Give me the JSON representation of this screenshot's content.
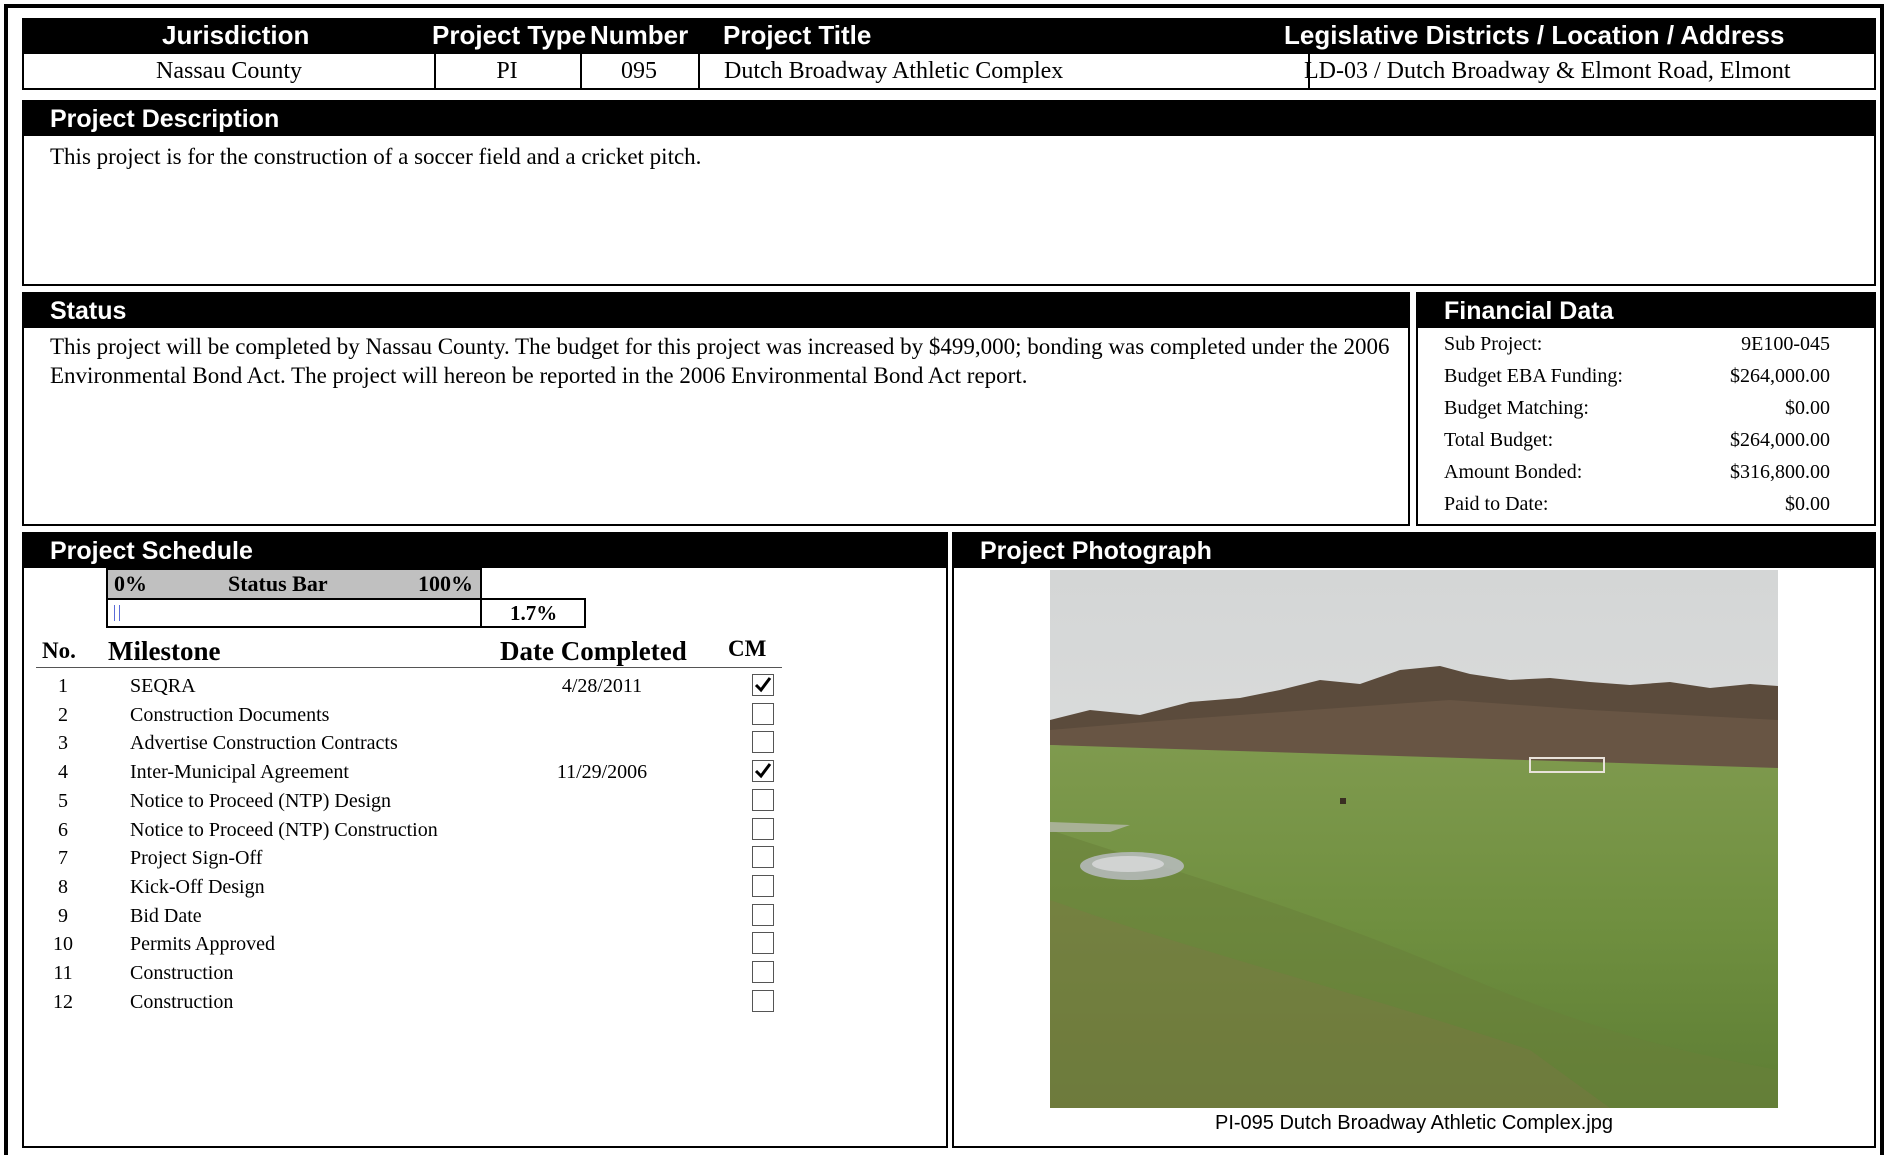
{
  "header": {
    "columns": [
      "Jurisdiction",
      "Project Type",
      "Number",
      "Project Title",
      "Legislative Districts / Location / Address"
    ],
    "values": {
      "jurisdiction": "Nassau County",
      "project_type": "PI",
      "number": "095",
      "project_title": "Dutch Broadway Athletic Complex",
      "location": "LD-03 / Dutch Broadway & Elmont Road, Elmont"
    }
  },
  "description": {
    "title": "Project Description",
    "text": "This project is for the construction of a soccer field and a cricket pitch."
  },
  "status": {
    "title": "Status",
    "text": "This project will be completed by Nassau County. The budget for this project was increased by $499,000; bonding was completed under the 2006 Environmental Bond Act. The project will hereon be reported in the 2006 Environmental Bond Act report."
  },
  "financial": {
    "title": "Financial Data",
    "rows": [
      {
        "label": "Sub Project:",
        "value": "9E100-045"
      },
      {
        "label": "Budget EBA Funding:",
        "value": "$264,000.00"
      },
      {
        "label": "Budget Matching:",
        "value": "$0.00"
      },
      {
        "label": "Total Budget:",
        "value": "$264,000.00"
      },
      {
        "label": "Amount Bonded:",
        "value": "$316,800.00"
      },
      {
        "label": "Paid to Date:",
        "value": "$0.00"
      }
    ]
  },
  "schedule": {
    "title": "Project Schedule",
    "status_bar": {
      "min_label": "0%",
      "label": "Status Bar",
      "max_label": "100%",
      "percent_text": "1.7%",
      "fraction": 0.017
    },
    "columns": {
      "no": "No.",
      "milestone": "Milestone",
      "date": "Date Completed",
      "cm": "CM"
    },
    "milestones": [
      {
        "no": "1",
        "name": "SEQRA",
        "date": "4/28/2011",
        "cm": true
      },
      {
        "no": "2",
        "name": "Construction Documents",
        "date": "",
        "cm": false
      },
      {
        "no": "3",
        "name": "Advertise Construction Contracts",
        "date": "",
        "cm": false
      },
      {
        "no": "4",
        "name": "Inter-Municipal Agreement",
        "date": "11/29/2006",
        "cm": true
      },
      {
        "no": "5",
        "name": "Notice to Proceed (NTP) Design",
        "date": "",
        "cm": false
      },
      {
        "no": "6",
        "name": "Notice to Proceed (NTP) Construction",
        "date": "",
        "cm": false
      },
      {
        "no": "7",
        "name": "Project Sign-Off",
        "date": "",
        "cm": false
      },
      {
        "no": "8",
        "name": "Kick-Off Design",
        "date": "",
        "cm": false
      },
      {
        "no": "9",
        "name": "Bid Date",
        "date": "",
        "cm": false
      },
      {
        "no": "10",
        "name": "Permits Approved",
        "date": "",
        "cm": false
      },
      {
        "no": "11",
        "name": "Construction",
        "date": "",
        "cm": false
      },
      {
        "no": "12",
        "name": "Construction",
        "date": "",
        "cm": false
      }
    ]
  },
  "photo": {
    "title": "Project Photograph",
    "caption": "PI-095 Dutch Broadway Athletic Complex.jpg"
  }
}
